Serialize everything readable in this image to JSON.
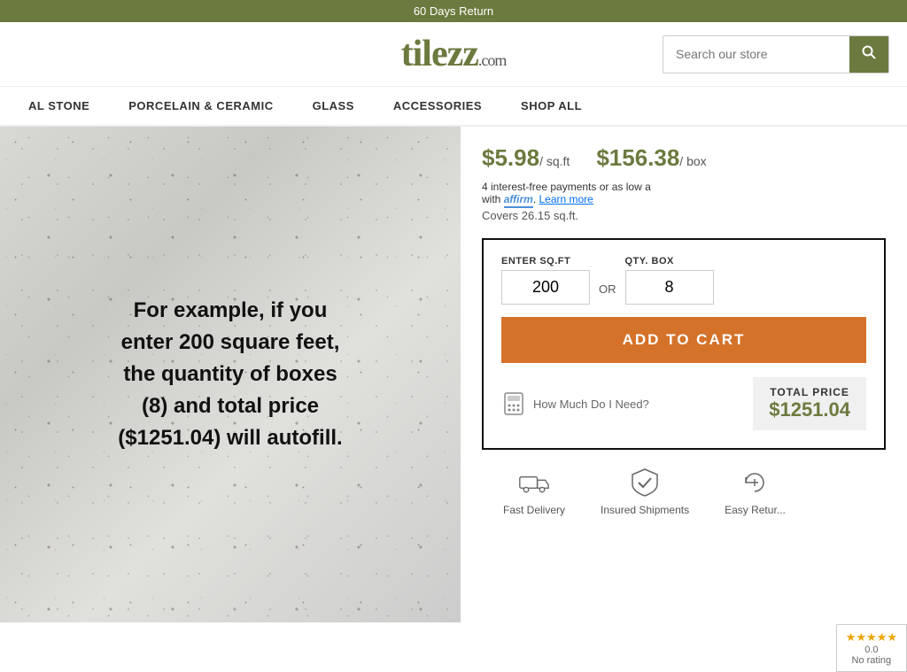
{
  "banner": {
    "text": "60 Days Return"
  },
  "header": {
    "logo": "tilezz",
    "logo_suffix": ".com",
    "search_placeholder": "Search our store"
  },
  "nav": {
    "items": [
      {
        "label": "AL STONE"
      },
      {
        "label": "PORCELAIN & CERAMIC"
      },
      {
        "label": "GLASS"
      },
      {
        "label": "ACCESSORIES"
      },
      {
        "label": "SHOP ALL"
      }
    ]
  },
  "product": {
    "price_sqft": "$5.98",
    "price_sqft_unit": "/ sq.ft",
    "price_box": "$156.38",
    "price_box_unit": "/ box",
    "affirm_text": "4 interest-free payments or as low a",
    "affirm_brand": "affirm",
    "affirm_link": "Learn more",
    "covers": "Covers 26.15 sq.ft.",
    "enter_sqft_label": "ENTER SQ.FT",
    "qty_box_label": "QTY. BOX",
    "sqft_value": "200",
    "qty_value": "8",
    "or_label": "OR",
    "add_to_cart": "ADD TO CART",
    "how_much": "How Much Do I Need?",
    "total_price_label": "TOTAL PRICE",
    "total_price_value": "$1251.04"
  },
  "overlay_text": "For example, if you enter 200 square feet, the quantity of boxes (8) and total price ($1251.04) will autofill.",
  "footer_icons": [
    {
      "label": "Fast Delivery"
    },
    {
      "label": "Insured Shipments"
    },
    {
      "label": "Easy Retur..."
    }
  ],
  "rating": {
    "score": "0.0",
    "label": "No rating"
  }
}
